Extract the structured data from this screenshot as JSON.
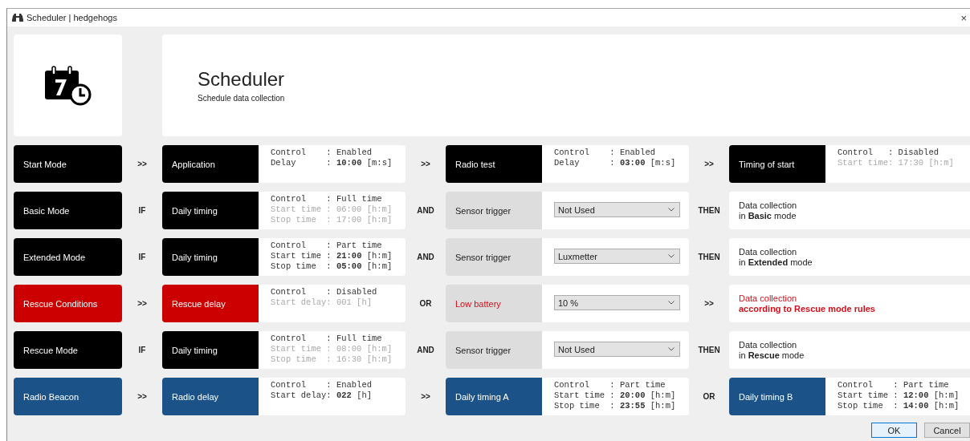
{
  "window": {
    "title": "Scheduler | hedgehogs",
    "close": "×"
  },
  "header": {
    "title": "Scheduler",
    "subtitle": "Schedule data collection"
  },
  "rows": [
    {
      "mode": {
        "label": "Start Mode",
        "color": "#000000"
      },
      "blocks": [
        {
          "connector": ">>",
          "kind": "info",
          "tile": {
            "label": "Application",
            "color": "#000000",
            "alert": false
          },
          "lines": [
            {
              "text": "Control    : Enabled",
              "dim": false
            },
            {
              "text": "Delay      : **10:00** [m:s]",
              "dim": false
            }
          ]
        },
        {
          "connector": ">>",
          "kind": "info",
          "tile": {
            "label": "Radio test",
            "color": "#000000",
            "alert": false
          },
          "lines": [
            {
              "text": "Control    : Enabled",
              "dim": false
            },
            {
              "text": "Delay      : **03:00** [m:s]",
              "dim": false
            }
          ]
        },
        {
          "connector": ">>",
          "kind": "info",
          "tile": {
            "label": "Timing of start",
            "color": "#000000",
            "alert": false
          },
          "lines": [
            {
              "text": "Control   : Disabled",
              "dim": false
            },
            {
              "text": "Start time: 17:30 [h:m]",
              "dim": true
            }
          ]
        }
      ]
    },
    {
      "mode": {
        "label": "Basic Mode",
        "color": "#000000"
      },
      "blocks": [
        {
          "connector": "IF",
          "kind": "info",
          "tile": {
            "label": "Daily timing",
            "color": "#000000",
            "alert": false
          },
          "lines": [
            {
              "text": "Control    : Full time",
              "dim": false
            },
            {
              "text": "Start time : 06:00 [h:m]",
              "dim": true
            },
            {
              "text": "Stop time  : 17:00 [h:m]",
              "dim": true
            }
          ]
        },
        {
          "connector": "AND",
          "kind": "select",
          "tile": {
            "label": "Sensor trigger",
            "color": "#dddddd",
            "alert": false
          },
          "value": "Not Used"
        },
        {
          "connector": "THEN",
          "kind": "result",
          "alert": false,
          "lines": [
            "Data collection",
            "in **Basic** mode"
          ]
        }
      ]
    },
    {
      "mode": {
        "label": "Extended Mode",
        "color": "#000000"
      },
      "blocks": [
        {
          "connector": "IF",
          "kind": "info",
          "tile": {
            "label": "Daily timing",
            "color": "#000000",
            "alert": false
          },
          "lines": [
            {
              "text": "Control    : Part time",
              "dim": false
            },
            {
              "text": "Start time : **21:00** [h:m]",
              "dim": false
            },
            {
              "text": "Stop time  : **05:00** [h:m]",
              "dim": false
            }
          ]
        },
        {
          "connector": "AND",
          "kind": "select",
          "tile": {
            "label": "Sensor trigger",
            "color": "#dddddd",
            "alert": false
          },
          "value": "Luxmetter"
        },
        {
          "connector": "THEN",
          "kind": "result",
          "alert": false,
          "lines": [
            "Data collection",
            "in **Extended** mode"
          ]
        }
      ]
    },
    {
      "mode": {
        "label": "Rescue Conditions",
        "color": "#cc0000"
      },
      "blocks": [
        {
          "connector": ">>",
          "kind": "info",
          "tile": {
            "label": "Rescue delay",
            "color": "#cc0000",
            "alert": false
          },
          "lines": [
            {
              "text": "Control    : Disabled",
              "dim": false
            },
            {
              "text": "Start delay: 001 [h]",
              "dim": true
            }
          ]
        },
        {
          "connector": "OR",
          "kind": "select",
          "tile": {
            "label": "Low battery",
            "color": "#dddddd",
            "alert": true
          },
          "value": "10 %"
        },
        {
          "connector": ">>",
          "kind": "result",
          "alert": true,
          "lines": [
            "Data collection",
            "**according to Rescue mode rules**"
          ]
        }
      ]
    },
    {
      "mode": {
        "label": "Rescue Mode",
        "color": "#000000"
      },
      "blocks": [
        {
          "connector": "IF",
          "kind": "info",
          "tile": {
            "label": "Daily timing",
            "color": "#000000",
            "alert": false
          },
          "lines": [
            {
              "text": "Control    : Full time",
              "dim": false
            },
            {
              "text": "Start time : 08:00 [h:m]",
              "dim": true
            },
            {
              "text": "Stop time  : 16:30 [h:m]",
              "dim": true
            }
          ]
        },
        {
          "connector": "AND",
          "kind": "select",
          "tile": {
            "label": "Sensor trigger",
            "color": "#dddddd",
            "alert": false
          },
          "value": "Not Used"
        },
        {
          "connector": "THEN",
          "kind": "result",
          "alert": false,
          "lines": [
            "Data collection",
            "in **Rescue** mode"
          ]
        }
      ]
    },
    {
      "mode": {
        "label": "Radio Beacon",
        "color": "#1b5388"
      },
      "blocks": [
        {
          "connector": ">>",
          "kind": "info",
          "tile": {
            "label": "Radio delay",
            "color": "#1b5388",
            "alert": false
          },
          "lines": [
            {
              "text": "Control    : Enabled",
              "dim": false
            },
            {
              "text": "Start delay: **022** [h]",
              "dim": false
            }
          ]
        },
        {
          "connector": ">>",
          "kind": "info",
          "tile": {
            "label": "Daily timing A",
            "color": "#1b5388",
            "alert": false
          },
          "lines": [
            {
              "text": "Control    : Part time",
              "dim": false
            },
            {
              "text": "Start time : **20:00** [h:m]",
              "dim": false
            },
            {
              "text": "Stop time  : **23:55** [h:m]",
              "dim": false
            }
          ]
        },
        {
          "connector": "OR",
          "kind": "info",
          "tile": {
            "label": "Daily timing B",
            "color": "#1b5388",
            "alert": false
          },
          "lines": [
            {
              "text": "Control    : Part time",
              "dim": false
            },
            {
              "text": "Start time : **12:00** [h:m]",
              "dim": false
            },
            {
              "text": "Stop time  : **14:00** [h:m]",
              "dim": false
            }
          ]
        }
      ]
    }
  ],
  "buttons": [
    {
      "label": "OK",
      "default": true
    },
    {
      "label": "Cancel",
      "default": false
    }
  ]
}
